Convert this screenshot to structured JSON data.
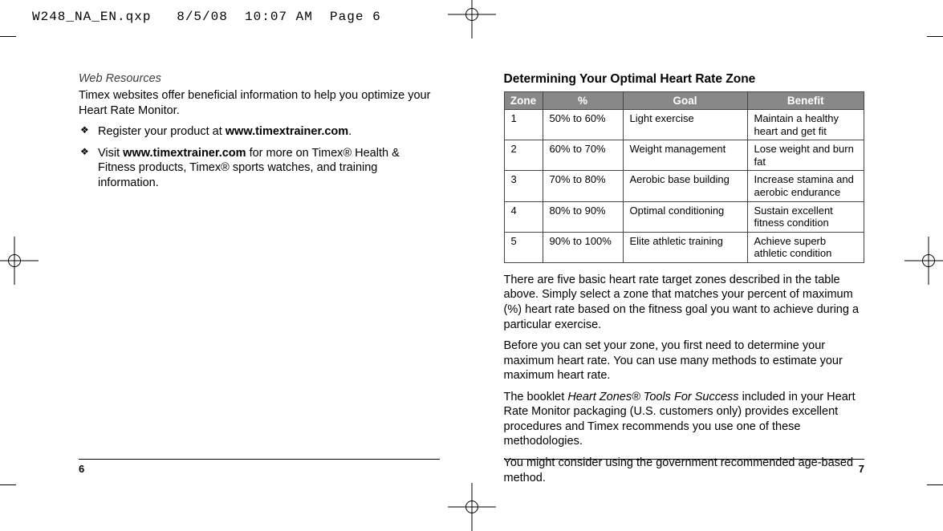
{
  "prepress": {
    "header": "W248_NA_EN.qxp   8/5/08  10:07 AM  Page 6"
  },
  "left_page": {
    "heading": "Web Resources",
    "intro": "Timex websites offer beneficial information to help you optimize your Heart Rate Monitor.",
    "bullets": [
      {
        "pre": "Register your product at ",
        "bold": "www.timextrainer.com",
        "post": "."
      },
      {
        "pre": "Visit ",
        "bold": "www.timextrainer.com",
        "post": " for more on Timex® Health & Fitness products, Timex® sports watches, and training information."
      }
    ],
    "page_number": "6"
  },
  "right_page": {
    "heading": "Determining Your Optimal Heart Rate Zone",
    "table": {
      "headers": [
        "Zone",
        "%",
        "Goal",
        "Benefit"
      ],
      "rows": [
        {
          "zone": "1",
          "pct": "50% to 60%",
          "goal": "Light exercise",
          "benefit": "Maintain a healthy heart and get fit"
        },
        {
          "zone": "2",
          "pct": "60% to 70%",
          "goal": "Weight management",
          "benefit": "Lose weight and burn fat"
        },
        {
          "zone": "3",
          "pct": "70% to 80%",
          "goal": "Aerobic base building",
          "benefit": "Increase stamina and aerobic endurance"
        },
        {
          "zone": "4",
          "pct": "80% to 90%",
          "goal": "Optimal conditioning",
          "benefit": "Sustain excellent fitness condition"
        },
        {
          "zone": "5",
          "pct": "90% to 100%",
          "goal": "Elite athletic training",
          "benefit": "Achieve superb athletic condition"
        }
      ]
    },
    "para1": "There are five basic heart rate target zones described in the table above. Simply select a zone that matches your percent of maximum (%) heart rate based on the fitness goal you want to achieve during a particular exercise.",
    "para2": "Before you can set your zone, you first need to determine your maximum heart rate. You can use many methods to estimate your maximum heart rate.",
    "para3_pre": "The booklet ",
    "para3_ital": "Heart Zones® Tools For Success",
    "para3_post": " included in your Heart Rate Monitor packaging (U.S. customers only) provides excellent procedures and Timex recommends you use one of these methodologies.",
    "para4": "You might consider using the government recommended age-based method.",
    "page_number": "7"
  }
}
